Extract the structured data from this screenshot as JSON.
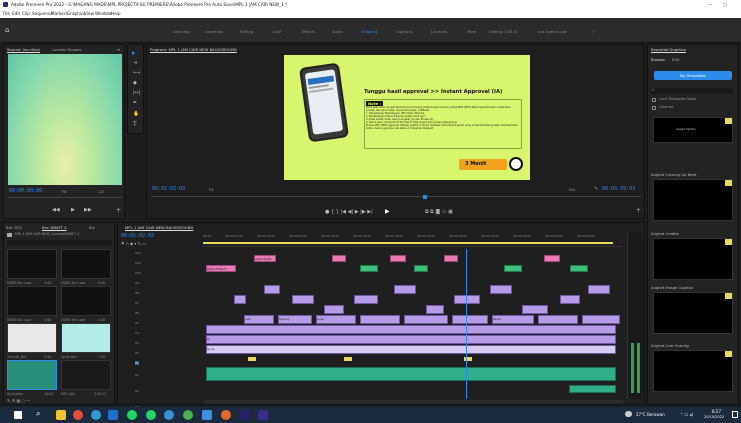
{
  "titlebar": {
    "title": "Adobe Premiere Pro 2022 - E:\\MAGANG MADE\\MPL PROJECT\\FILE PREMIERE\\Adobe Premiere Pro Auto-Save\\MPL 1 JAM CAIR NEW_1 *"
  },
  "menu": [
    "File",
    "Edit",
    "Clip",
    "Sequence",
    "Markers",
    "Graphics",
    "View",
    "Window",
    "Help"
  ],
  "workspaces": [
    "Learning",
    "Assembly",
    "Editing",
    "Color",
    "Effects",
    "Audio",
    "Graphics",
    "Captions",
    "Libraries",
    "More",
    "Editing (CS5.5)",
    "cus tigerim joel"
  ],
  "source_panel": {
    "tabs": [
      "Source: (no clips)",
      "Lumetri Scopes"
    ],
    "timecode_left": "00:00:00:00",
    "fit": "Fit",
    "ratio": "1/2"
  },
  "program_panel": {
    "title": "Program: MPL 1 JAM CAIR NEW BACKGROUND",
    "timecode": "00:02:02:03",
    "fit": "Fit",
    "quality": "Full",
    "duration": "00:03:39:03",
    "slide": {
      "heading": "Tunggu hasil approval >> Instant Approval (IA)",
      "note_label": "Note :",
      "note_intro": "Pada saat kamu proses Permohonan Funding Instant Approval (IA), pihak MPC JMTR (Bank Syariah) akan melakukan proses, dan kamu akan menerima pesan notifikasi:",
      "note_lines": [
        "1. Persetujuan Pembiayaan (PP) telah diterima",
        "2. Pembayaran Harus Dilunasi dalam 1x24 jam",
        "3. Data sudah dicek ulang Lengkap (S) dan Proses (A)",
        "4. Kamu akan menerima Informasi Tindak Lanjut dan proses selanjutnya"
      ],
      "note_footer": "Proses MPC JMTR Approval (Tahap) sekitar 5 menit. Aplikasi Indomaret Syariah yang sudah terhubung akan memberitahu kamu. Kamu juga bisa cek status di halaman Riwayat.",
      "timer": "3 Menit"
    }
  },
  "project_panel": {
    "tabs": [
      "Bin: SFX",
      "Bin: DRAFT 4",
      "Bin"
    ],
    "path": "MPL 1 JAM CAIR NEW_1.prproj\\DRAFT 4",
    "items": [
      {
        "name": "DDRB Bni Lowi",
        "duration": "4:00"
      },
      {
        "name": "DDRB Bni Lowi",
        "duration": "4:00"
      },
      {
        "name": "DDRB Bni Lowi",
        "duration": "4:00"
      },
      {
        "name": "DDRB Bni Lowi",
        "duration": "4:00"
      },
      {
        "name": "Transisi_Bni",
        "duration": "2:00"
      },
      {
        "name": "Sp Button",
        "duration": "7:00"
      },
      {
        "name": "Sp Button",
        "duration": "10:00"
      },
      {
        "name": "MPL LIJA",
        "duration": "3:44:21"
      }
    ]
  },
  "timeline": {
    "tab": "MPL 1 JAM CAIR NEW BACKGROUND",
    "timecode": "00:02:02:03",
    "ruler": [
      "00:00",
      "00:00:15:00",
      "00:00:30:00",
      "00:00:45:00",
      "00:01:00:00",
      "00:01:15:00",
      "00:01:30:00",
      "00:01:45:00",
      "00:02:00:00",
      "00:02:15:00",
      "00:02:30:00",
      "00:02:45:00",
      "00:03:00:00"
    ],
    "video_tracks": [
      "V12",
      "V11",
      "V10",
      "V9",
      "V8",
      "V7",
      "V6",
      "V5",
      "V4",
      "V3",
      "V2",
      "V1"
    ],
    "audio_tracks": [
      "A1",
      "A2",
      "A3"
    ],
    "clip_labels": [
      "LOGO-ADIRA-FI",
      "LOGO-ADIRA",
      "Anto",
      "Spacing",
      "Scapi",
      "Stroke",
      "sp",
      "hp",
      "Sp",
      "Sp hp",
      "LOGO",
      "LOGO-ADI"
    ]
  },
  "essential_graphics": {
    "title": "Essential Graphics",
    "tabs": [
      "Browse",
      "Edit"
    ],
    "search_button": "My Templates",
    "options": [
      "Local Templates Folder",
      "Libraries"
    ],
    "templates": [
      "Angled Caption",
      "Angled Coming Up Next",
      "Angled Credits",
      "Angled Image Caption",
      "Angled Line Overlay"
    ]
  },
  "taskbar": {
    "weather": "27°C  Berawan",
    "time": "8:27",
    "date": "20/10/2022"
  },
  "colors": {
    "accent": "#2d8ceb",
    "slide_bg": "#d8f56e",
    "clip_video": "#b69ce6",
    "clip_pink": "#e879b5",
    "clip_green": "#3fbf7a",
    "clip_yellow": "#e7d85a",
    "clip_audio": "#2fae8a"
  }
}
